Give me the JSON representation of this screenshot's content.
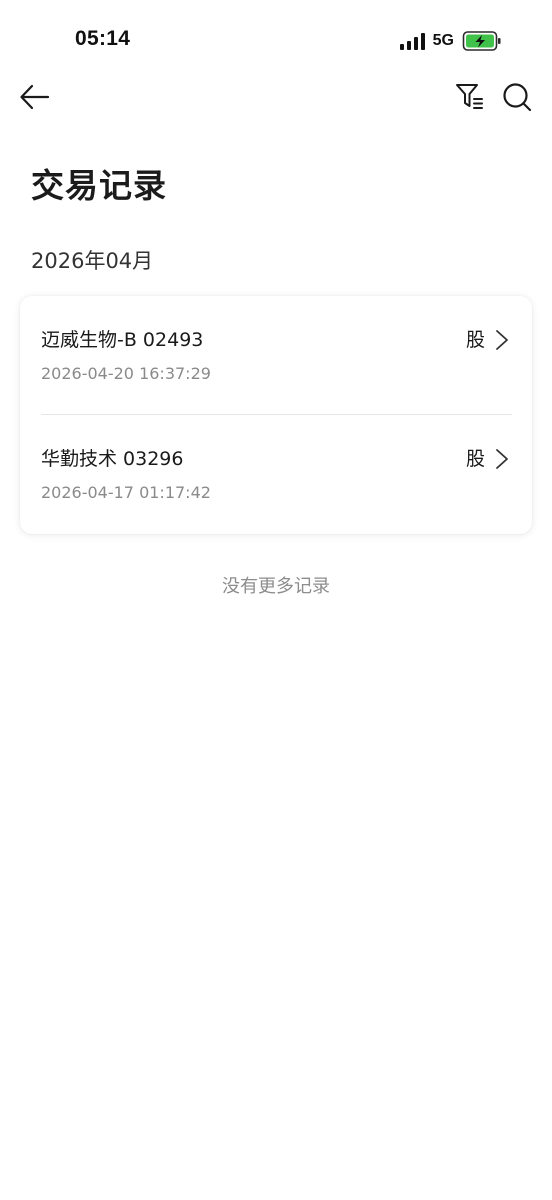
{
  "status_bar": {
    "time": "05:14",
    "network": "5G",
    "icons": [
      "signal-icon",
      "battery-charging-icon"
    ],
    "battery_color": "#3fc14a"
  },
  "nav": {
    "icons": [
      "back-arrow-icon",
      "filter-icon",
      "search-icon"
    ]
  },
  "page": {
    "title": "交易记录",
    "month": "2026年04月"
  },
  "records": [
    {
      "name": "迈威生物-B 02493",
      "time": "2026-04-20 16:37:29",
      "type": "股"
    },
    {
      "name": "华勤技术 03296",
      "time": "2026-04-17 01:17:42",
      "type": "股"
    }
  ],
  "footer": {
    "end_note": "没有更多记录"
  }
}
